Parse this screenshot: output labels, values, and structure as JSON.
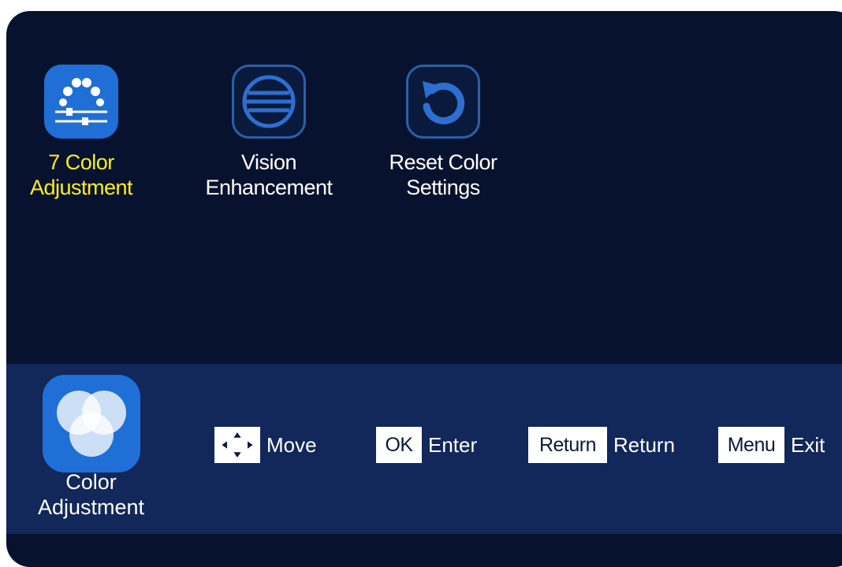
{
  "menu": {
    "items": [
      {
        "line1": "7 Color",
        "line2": "Adjustment",
        "icon": "color-sliders-icon",
        "selected": true
      },
      {
        "line1": "Vision",
        "line2": "Enhancement",
        "icon": "vision-lines-icon",
        "selected": false
      },
      {
        "line1": "Reset Color",
        "line2": "Settings",
        "icon": "reset-arrow-icon",
        "selected": false
      }
    ]
  },
  "footer": {
    "current_section": {
      "line1": "Color",
      "line2": "Adjustment",
      "icon": "color-circles-icon"
    },
    "hints": [
      {
        "key": "",
        "key_icon": "dpad-arrows-icon",
        "label": "Move"
      },
      {
        "key": "OK",
        "label": "Enter"
      },
      {
        "key": "Return",
        "label": "Return"
      },
      {
        "key": "Menu",
        "label": "Exit"
      }
    ]
  },
  "colors": {
    "background": "#07132e",
    "footer_background": "#12275a",
    "accent_blue": "#1f6fd6",
    "selected_text": "#ffee1a",
    "text": "#ffffff"
  }
}
